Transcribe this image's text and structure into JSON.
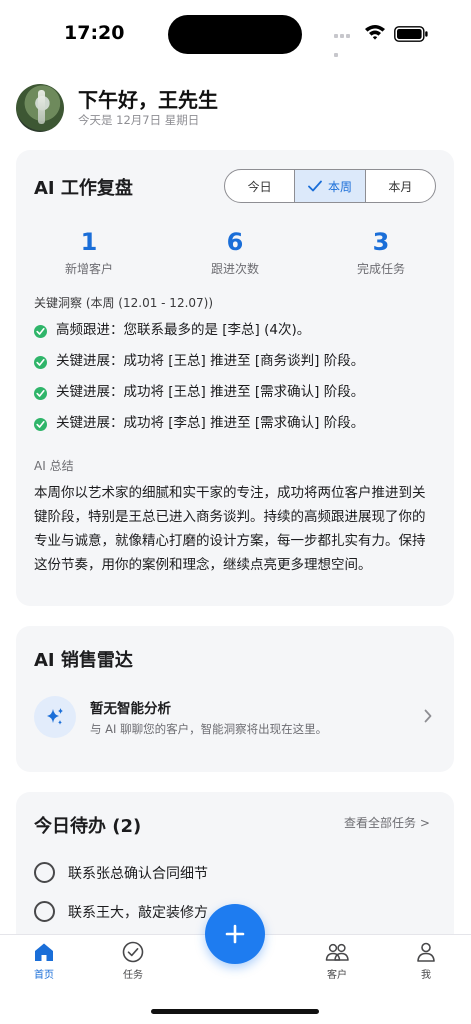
{
  "status_bar": {
    "time": "17:20"
  },
  "header": {
    "greeting": "下午好，王先生",
    "date_line": "今天是 12月7日 星期日"
  },
  "review": {
    "title": "AI 工作复盘",
    "tabs": [
      {
        "label": "今日",
        "active": false
      },
      {
        "label": "本周",
        "active": true
      },
      {
        "label": "本月",
        "active": false
      }
    ],
    "stats": [
      {
        "value": "1",
        "label": "新增客户"
      },
      {
        "value": "6",
        "label": "跟进次数"
      },
      {
        "value": "3",
        "label": "完成任务"
      }
    ],
    "insight_heading": "关键洞察 (本周 (12.01 - 12.07))",
    "insights": [
      "高频跟进：您联系最多的是 [李总] (4次)。",
      "关键进展：成功将 [王总] 推进至 [商务谈判] 阶段。",
      "关键进展：成功将 [王总] 推进至 [需求确认] 阶段。",
      "关键进展：成功将 [李总] 推进至 [需求确认] 阶段。"
    ],
    "summary_heading": "AI 总结",
    "summary_text": "本周你以艺术家的细腻和实干家的专注，成功将两位客户推进到关键阶段，特别是王总已进入商务谈判。持续的高频跟进展现了你的专业与诚意，就像精心打磨的设计方案，每一步都扎实有力。保持这份节奏，用你的案例和理念，继续点亮更多理想空间。"
  },
  "radar": {
    "title": "AI 销售雷达",
    "empty_title": "暂无智能分析",
    "empty_subtitle": "与 AI 聊聊您的客户，智能洞察将出现在这里。"
  },
  "todo": {
    "title": "今日待办 (2)",
    "see_all": "查看全部任务 >",
    "items": [
      {
        "label": "联系张总确认合同细节"
      },
      {
        "label": "联系王大，敲定装修方"
      }
    ]
  },
  "tabbar": {
    "items": [
      {
        "label": "首页",
        "icon": "home-icon",
        "active": true
      },
      {
        "label": "任务",
        "icon": "task-check-icon",
        "active": false
      },
      {
        "label": "客户",
        "icon": "customers-icon",
        "active": false
      },
      {
        "label": "我",
        "icon": "profile-icon",
        "active": false
      }
    ]
  },
  "colors": {
    "accent": "#1a6ed8",
    "fab": "#1e7cf0",
    "success": "#2fb56a",
    "card_bg": "#f5f6f8"
  }
}
